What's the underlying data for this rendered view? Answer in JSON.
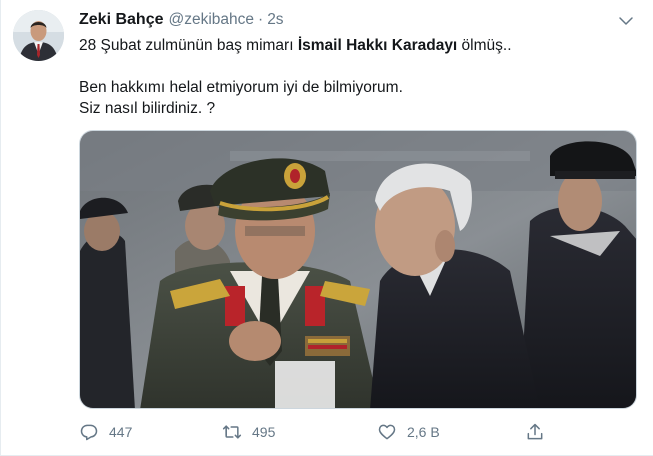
{
  "tweet": {
    "author_name": "Zeki Bahçe",
    "author_handle": "@zekibahce",
    "separator": "·",
    "time": "2s",
    "text": {
      "line1_pre": "28 Şubat zulmünün baş mimarı ",
      "line1_bold": "İsmail Hakkı Karadayı",
      "line1_post": " ölmüş..",
      "line2": "Ben hakkımı helal etmiyorum iyi de bilmiyorum.",
      "line3": "Siz nasıl bilirdiniz. ?"
    },
    "stats": {
      "replies": "447",
      "retweets": "495",
      "likes": "2,6 B"
    }
  },
  "icons": {
    "caret": "chevron-down-icon",
    "reply": "reply-icon",
    "retweet": "retweet-icon",
    "like": "heart-icon",
    "share": "share-icon"
  },
  "colors": {
    "text_primary": "#14171a",
    "text_secondary": "#657786",
    "border": "#e6ecf0"
  }
}
